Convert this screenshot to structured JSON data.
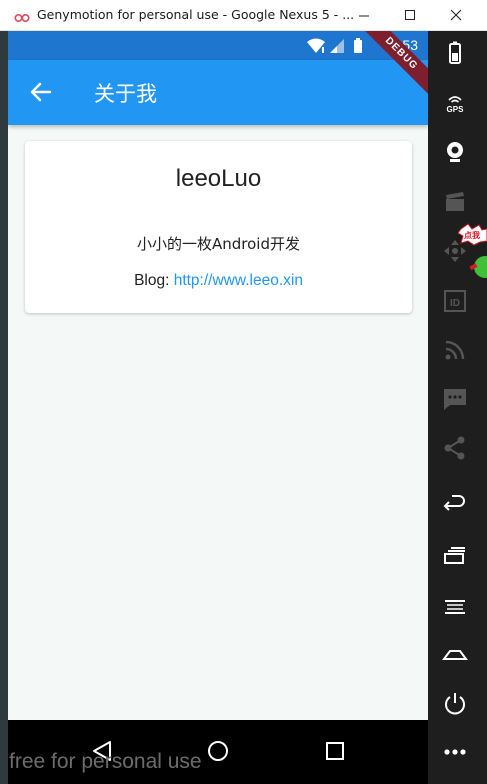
{
  "window": {
    "title": "Genymotion for personal use - Google Nexus 5 - ..."
  },
  "status_bar": {
    "time": "11:53"
  },
  "debug_banner": "DEBUG",
  "app_bar": {
    "title": "关于我"
  },
  "card": {
    "name": "leeoLuo",
    "description": "小小的一枚Android开发",
    "blog_label": "Blog: ",
    "blog_url": "http://www.leeo.xin"
  },
  "watermark": "free for personal use",
  "sticker_text": "点我",
  "toolbar_icons": [
    "battery-icon",
    "gps-icon",
    "webcam-icon",
    "movie-icon",
    "dpad-icon",
    "id-icon",
    "rss-icon",
    "sms-icon",
    "share-icon",
    "back-icon",
    "recent-apps-icon",
    "menu-icon",
    "home-icon",
    "power-icon",
    "more-icon"
  ],
  "colors": {
    "app_bar": "#2196f3",
    "status_bar": "#1e76cf",
    "link": "#2196f3",
    "debug_banner": "#7d1f2e",
    "toolbar": "#1e1e1e"
  }
}
